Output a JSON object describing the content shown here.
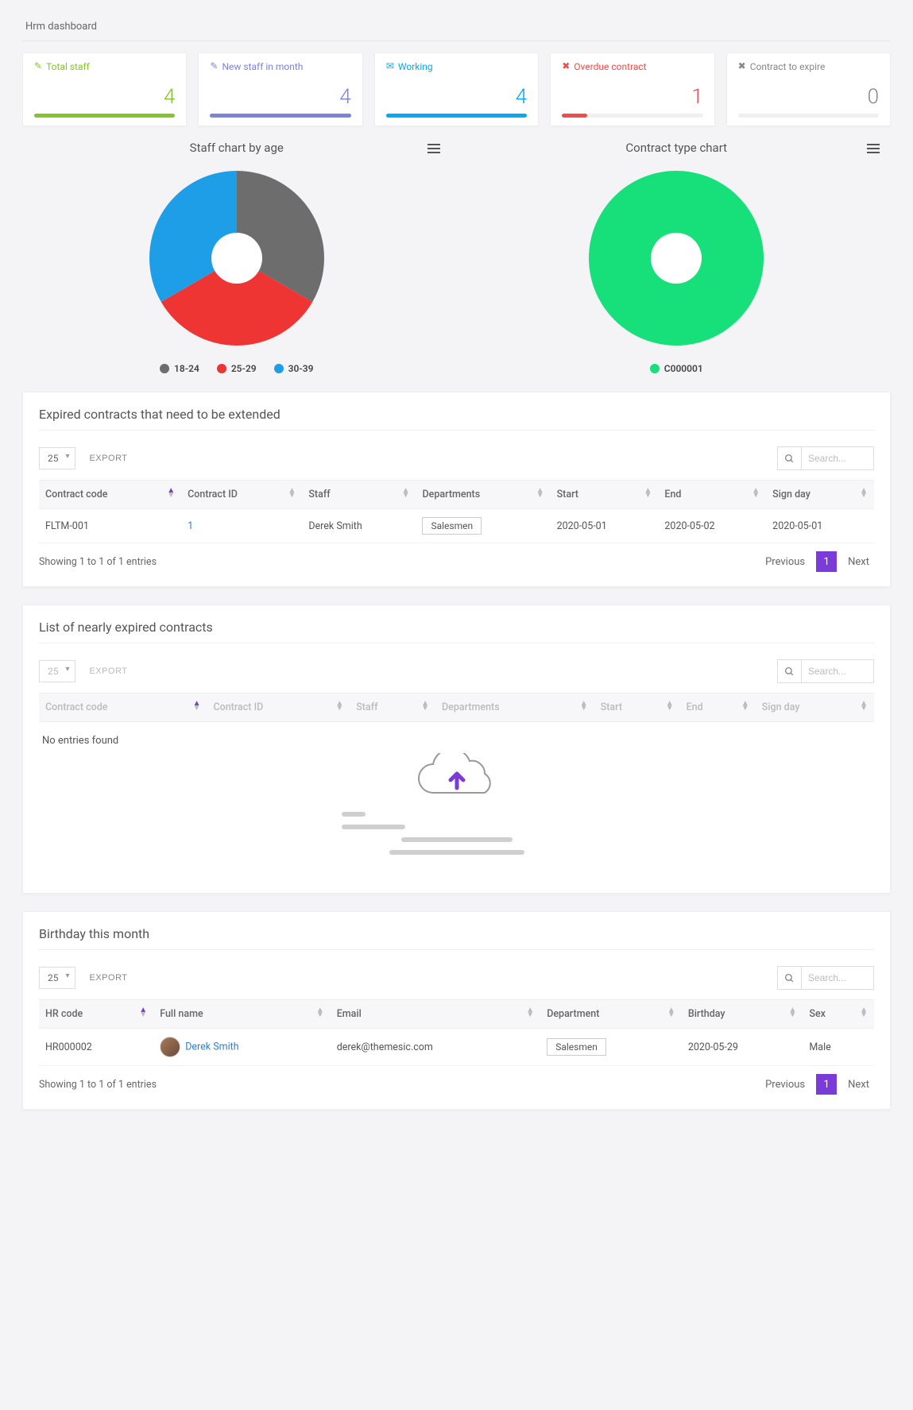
{
  "page_title": "Hrm dashboard",
  "stats": [
    {
      "label": "Total staff",
      "value": "4",
      "color": "green",
      "fill": 100,
      "icon": "✎"
    },
    {
      "label": "New staff in month",
      "value": "4",
      "color": "blue",
      "fill": 100,
      "icon": "✎"
    },
    {
      "label": "Working",
      "value": "4",
      "color": "cyan",
      "fill": 100,
      "icon": "✉"
    },
    {
      "label": "Overdue contract",
      "value": "1",
      "color": "red",
      "fill": 18,
      "icon": "✖"
    },
    {
      "label": "Contract to expire",
      "value": "0",
      "color": "grey",
      "fill": 0,
      "icon": "✖"
    }
  ],
  "chart_left": {
    "title": "Staff chart by age",
    "legend": [
      {
        "label": "18-24",
        "color": "#6d6d6d"
      },
      {
        "label": "25-29",
        "color": "#ef3434"
      },
      {
        "label": "30-39",
        "color": "#1f9ee8"
      }
    ]
  },
  "chart_right": {
    "title": "Contract type chart",
    "legend": [
      {
        "label": "C000001",
        "color": "#17e07b"
      }
    ]
  },
  "chart_data": [
    {
      "type": "pie",
      "title": "Staff chart by age",
      "series": [
        {
          "name": "18-24",
          "value": 33.3,
          "color": "#6d6d6d"
        },
        {
          "name": "25-29",
          "value": 33.3,
          "color": "#ef3434"
        },
        {
          "name": "30-39",
          "value": 33.3,
          "color": "#1f9ee8"
        }
      ]
    },
    {
      "type": "pie",
      "title": "Contract type chart",
      "series": [
        {
          "name": "C000001",
          "value": 100,
          "color": "#17e07b"
        }
      ]
    }
  ],
  "common": {
    "page_size": "25",
    "export": "EXPORT",
    "search_placeholder": "Search...",
    "prev": "Previous",
    "next": "Next",
    "page_current": "1"
  },
  "expired": {
    "title": "Expired contracts that need to be extended",
    "columns": [
      "Contract code",
      "Contract ID",
      "Staff",
      "Departments",
      "Start",
      "End",
      "Sign day"
    ],
    "row": {
      "code": "FLTM-001",
      "id": "1",
      "staff": "Derek Smith",
      "dept": "Salesmen",
      "start": "2020-05-01",
      "end": "2020-05-02",
      "sign": "2020-05-01"
    },
    "footer": "Showing 1 to 1 of 1 entries"
  },
  "nearly": {
    "title": "List of nearly expired contracts",
    "columns": [
      "Contract code",
      "Contract ID",
      "Staff",
      "Departments",
      "Start",
      "End",
      "Sign day"
    ],
    "empty": "No entries found"
  },
  "birthday": {
    "title": "Birthday this month",
    "columns": [
      "HR code",
      "Full name",
      "Email",
      "Department",
      "Birthday",
      "Sex"
    ],
    "row": {
      "code": "HR000002",
      "name": "Derek Smith",
      "email": "derek@themesic.com",
      "dept": "Salesmen",
      "birthday": "2020-05-29",
      "sex": "Male"
    },
    "footer": "Showing 1 to 1 of 1 entries"
  }
}
